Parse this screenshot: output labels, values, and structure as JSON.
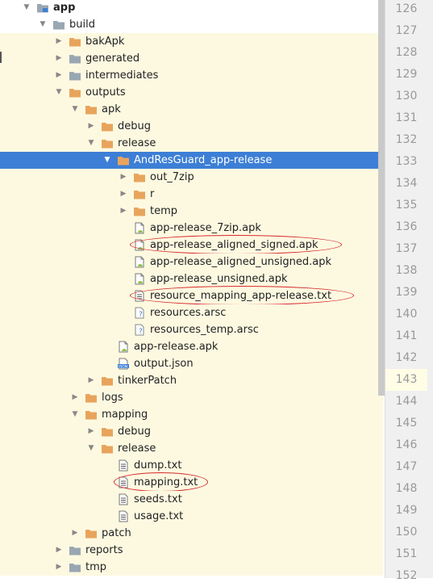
{
  "tree": [
    {
      "label": "app",
      "depth": 0,
      "type": "module",
      "expanded": true,
      "bold": true
    },
    {
      "label": "build",
      "depth": 1,
      "type": "folder-gray",
      "expanded": true
    },
    {
      "label": "bakApk",
      "depth": 2,
      "type": "folder",
      "expanded": false
    },
    {
      "label": "generated",
      "depth": 2,
      "type": "folder-gray",
      "expanded": false
    },
    {
      "label": "intermediates",
      "depth": 2,
      "type": "folder-gray",
      "expanded": false
    },
    {
      "label": "outputs",
      "depth": 2,
      "type": "folder",
      "expanded": true
    },
    {
      "label": "apk",
      "depth": 3,
      "type": "folder",
      "expanded": true
    },
    {
      "label": "debug",
      "depth": 4,
      "type": "folder",
      "expanded": false
    },
    {
      "label": "release",
      "depth": 4,
      "type": "folder",
      "expanded": true
    },
    {
      "label": "AndResGuard_app-release",
      "depth": 5,
      "type": "folder",
      "expanded": true,
      "selected": true
    },
    {
      "label": "out_7zip",
      "depth": 6,
      "type": "folder",
      "expanded": false
    },
    {
      "label": "r",
      "depth": 6,
      "type": "folder",
      "expanded": false
    },
    {
      "label": "temp",
      "depth": 6,
      "type": "folder",
      "expanded": false
    },
    {
      "label": "app-release_7zip.apk",
      "depth": 6,
      "type": "apk"
    },
    {
      "label": "app-release_aligned_signed.apk",
      "depth": 6,
      "type": "apk",
      "circled": true
    },
    {
      "label": "app-release_aligned_unsigned.apk",
      "depth": 6,
      "type": "apk"
    },
    {
      "label": "app-release_unsigned.apk",
      "depth": 6,
      "type": "apk"
    },
    {
      "label": "resource_mapping_app-release.txt",
      "depth": 6,
      "type": "txt",
      "circled": true
    },
    {
      "label": "resources.arsc",
      "depth": 6,
      "type": "unknown"
    },
    {
      "label": "resources_temp.arsc",
      "depth": 6,
      "type": "unknown"
    },
    {
      "label": "app-release.apk",
      "depth": 5,
      "type": "apk"
    },
    {
      "label": "output.json",
      "depth": 5,
      "type": "json"
    },
    {
      "label": "tinkerPatch",
      "depth": 4,
      "type": "folder",
      "expanded": false
    },
    {
      "label": "logs",
      "depth": 3,
      "type": "folder",
      "expanded": false
    },
    {
      "label": "mapping",
      "depth": 3,
      "type": "folder",
      "expanded": true
    },
    {
      "label": "debug",
      "depth": 4,
      "type": "folder",
      "expanded": false
    },
    {
      "label": "release",
      "depth": 4,
      "type": "folder",
      "expanded": true
    },
    {
      "label": "dump.txt",
      "depth": 5,
      "type": "txt"
    },
    {
      "label": "mapping.txt",
      "depth": 5,
      "type": "txt",
      "circled": true
    },
    {
      "label": "seeds.txt",
      "depth": 5,
      "type": "txt"
    },
    {
      "label": "usage.txt",
      "depth": 5,
      "type": "txt"
    },
    {
      "label": "patch",
      "depth": 3,
      "type": "folder",
      "expanded": false
    },
    {
      "label": "reports",
      "depth": 2,
      "type": "folder-gray",
      "expanded": false
    },
    {
      "label": "tmp",
      "depth": 2,
      "type": "folder-gray",
      "expanded": false
    }
  ],
  "json_badge": "JSON",
  "line_numbers": [
    "126",
    "127",
    "128",
    "129",
    "130",
    "131",
    "132",
    "133",
    "134",
    "135",
    "136",
    "137",
    "138",
    "139",
    "140",
    "141",
    "142",
    "143",
    "144",
    "145",
    "146",
    "147",
    "148",
    "149",
    "150",
    "151",
    "152"
  ],
  "current_line": "143",
  "colors": {
    "selection": "#3d7fd6",
    "highlight": "#fdf9e1",
    "folder": "#e8a45c",
    "folder_gray": "#9aa7b2",
    "circle": "#d62a2a"
  }
}
